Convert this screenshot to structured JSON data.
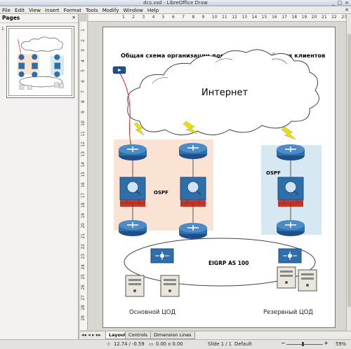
{
  "window": {
    "title": "dcs.vsd - LibreOffice Draw"
  },
  "menu": [
    "File",
    "Edit",
    "View",
    "Insert",
    "Format",
    "Tools",
    "Modify",
    "Window",
    "Help"
  ],
  "pages_panel": {
    "title": "Pages",
    "page_number": "1"
  },
  "ruler": {
    "h_ticks": [
      "1",
      "2",
      "3",
      "4",
      "5",
      "6",
      "7",
      "8",
      "9",
      "10",
      "11",
      "12",
      "13",
      "14",
      "15",
      "16",
      "17",
      "18",
      "19",
      "20",
      "21",
      "22",
      "23"
    ],
    "v_ticks": [
      "1",
      "2",
      "3",
      "4",
      "5",
      "6",
      "7",
      "8",
      "9",
      "10",
      "11",
      "12",
      "13",
      "14",
      "15",
      "16",
      "17",
      "18",
      "19",
      "20",
      "21",
      "22",
      "23",
      "24",
      "25",
      "26",
      "27",
      "28",
      "29"
    ]
  },
  "diagram": {
    "title": "Общая схема организации доступа для удалённых клиентов",
    "cloud_label": "Интернет",
    "ospf_left": "OSPF",
    "ospf_right": "OSPF",
    "eigrp_label": "EIGRP AS 100",
    "dc_main": "Основной ЦОД",
    "dc_reserve": "Резервный ЦОД"
  },
  "tabs": [
    "Layout",
    "Controls",
    "Dimension Lines"
  ],
  "status": {
    "position": "12.74 / -0.59",
    "size": "0.00 x 0.00",
    "slide": "Slide 1 / 1",
    "layout": "Default",
    "zoom": "59%"
  },
  "colors": {
    "router": "#2f6fa8",
    "firewall_red": "#c0392b",
    "ospf_left_zone": "#fbe3d4",
    "ospf_right_zone": "#d6e8f2",
    "lightning": "#e8e000",
    "red_link": "#e02020"
  }
}
